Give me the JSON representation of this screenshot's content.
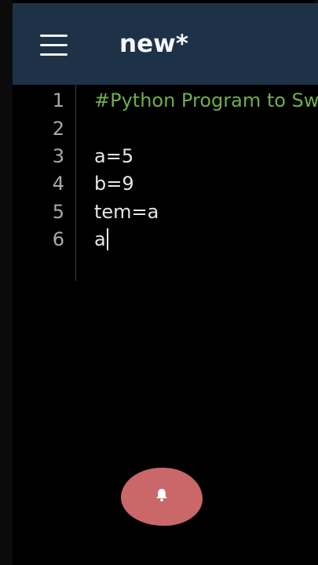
{
  "app_bar": {
    "title": "new*",
    "menu_icon": "hamburger-menu-icon",
    "background": "#1d3246"
  },
  "editor": {
    "line_numbers": [
      "1",
      "2",
      "3",
      "4",
      "5",
      "6"
    ],
    "lines": [
      "#Python Program to Swap",
      "",
      "a=5",
      "b=9",
      "tem=a",
      "a"
    ],
    "comment_color": "#6fae4c",
    "text_color": "#e6e6e6"
  },
  "overlay": {
    "icon": "bell-icon",
    "color": "#c96769"
  }
}
